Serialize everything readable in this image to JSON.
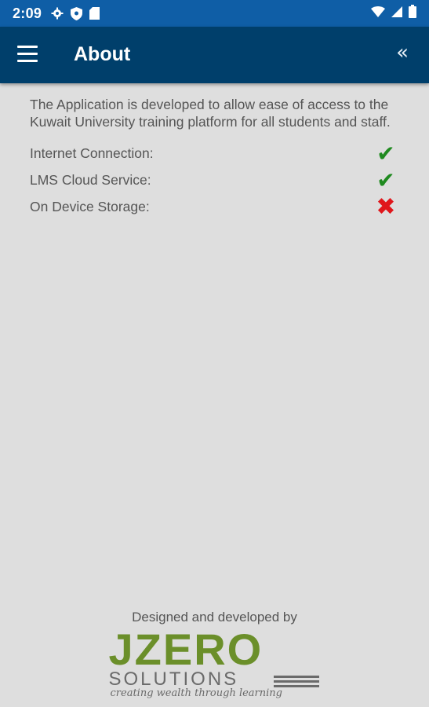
{
  "status_bar": {
    "time": "2:09",
    "left_icons": [
      "gear-icon",
      "shield-icon",
      "sd-card-icon"
    ],
    "right_icons": [
      "wifi-icon",
      "signal-icon",
      "battery-icon"
    ]
  },
  "app_bar": {
    "title": "About",
    "menu_icon": "hamburger-menu-icon",
    "collapse_icon": "double-chevron-left-icon",
    "collapse_glyph": "«"
  },
  "content": {
    "description": "The Application is developed to allow ease of access to the Kuwait University training platform for all students and staff.",
    "checks": [
      {
        "label": "Internet Connection:",
        "status": "ok",
        "glyph": "✔"
      },
      {
        "label": "LMS Cloud Service:",
        "status": "ok",
        "glyph": "✔"
      },
      {
        "label": "On Device Storage:",
        "status": "fail",
        "glyph": "✖"
      }
    ]
  },
  "footer": {
    "credit": "Designed and developed by",
    "logo_main": "JZERO",
    "logo_sub": "SOLUTIONS",
    "logo_tagline": "creating wealth through learning"
  },
  "colors": {
    "status_bar": "#0f5ea6",
    "app_bar": "#003f6b",
    "background": "#dedede",
    "ok": "#1f8a1f",
    "fail": "#e0161b",
    "logo_green": "#6b8f2a"
  }
}
